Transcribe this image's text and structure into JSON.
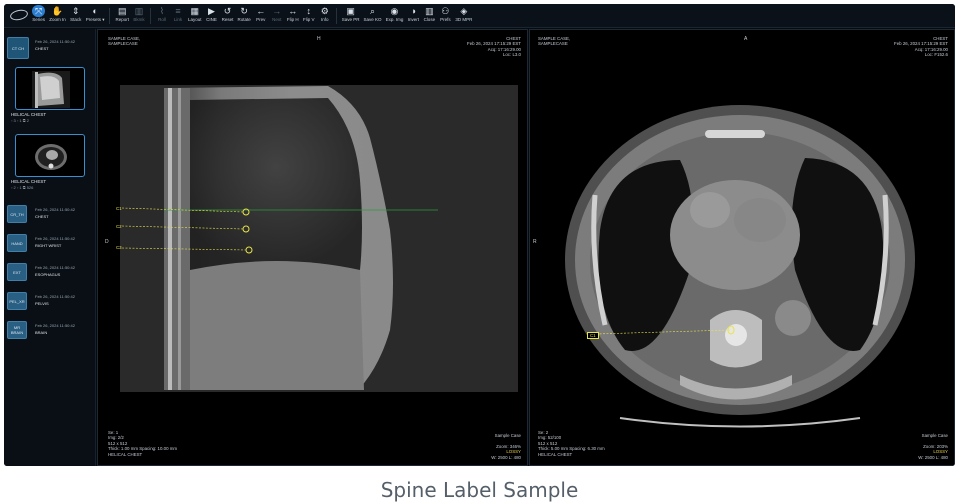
{
  "toolbar": {
    "tools": [
      {
        "icon": "⤧",
        "label": "Series",
        "active": true
      },
      {
        "icon": "✋",
        "label": "Zoom In"
      },
      {
        "icon": "⇕",
        "label": "Stack"
      },
      {
        "icon": "◐",
        "label": "Presets ▾"
      },
      {
        "icon": "▤",
        "label": "Report"
      },
      {
        "icon": "▥",
        "label": "Bkmk",
        "dim": true
      },
      {
        "icon": "⌇",
        "label": "Roll",
        "dim": true
      },
      {
        "icon": "≡",
        "label": "Link",
        "dim": true
      },
      {
        "icon": "▦",
        "label": "Layout"
      },
      {
        "icon": "▶",
        "label": "CINE"
      },
      {
        "icon": "↺",
        "label": "Reset"
      },
      {
        "icon": "↻",
        "label": "Rotate"
      },
      {
        "icon": "←",
        "label": "Prev"
      },
      {
        "icon": "→",
        "label": "Next",
        "dim": true
      },
      {
        "icon": "↔",
        "label": "Flip H"
      },
      {
        "icon": "↕",
        "label": "Flip V"
      },
      {
        "icon": "⚙",
        "label": "Info"
      },
      {
        "icon": "▣",
        "label": "Save PR"
      },
      {
        "icon": "⌕",
        "label": "Save KO"
      },
      {
        "icon": "◉",
        "label": "Exp. Img"
      },
      {
        "icon": "◑",
        "label": "Invert"
      },
      {
        "icon": "▥",
        "label": "Close"
      },
      {
        "icon": "⚇",
        "label": "Prefs"
      },
      {
        "icon": "◈",
        "label": "3D MPR"
      }
    ]
  },
  "sidebar": {
    "study": {
      "abbr": "CT CH",
      "date": "Feb 26, 2024 11:50:42",
      "name": "CHEST"
    },
    "thumbs": [
      {
        "name": "HELICAL CHEST",
        "meta": "▫ 3        ▫ 1                    ⧉ 2"
      },
      {
        "name": "HELICAL CHEST",
        "meta": "▫ 2        ▫ 1              ⧉ 526"
      }
    ],
    "series": [
      {
        "abbr": "CR_TH",
        "date": "Feb 26, 2024 11:50:42",
        "name": "CHEST"
      },
      {
        "abbr": "HAND",
        "date": "Feb 26, 2024 11:50:42",
        "name": "RIGHT WRIST"
      },
      {
        "abbr": "EXT",
        "date": "Feb 26, 2024 11:50:42",
        "name": "ESOPHAGUS"
      },
      {
        "abbr": "PEL_XR",
        "date": "Feb 26, 2024 11:50:42",
        "name": "PELVIS"
      },
      {
        "abbr": "MR BRAIN",
        "date": "Feb 26, 2024 11:50:42",
        "name": "BRAIN"
      }
    ]
  },
  "viewport_left": {
    "top_left": "SAMPLE CASE,\nSAMPLECASE",
    "top_center": "H",
    "left_mid": "D",
    "bottom_left": "Se: 1\nImg: 2/2\n512 x 512\nThick: 1.00 mm Spacing: 10.00 mm\nHELICAL CHEST",
    "bottom_right_1": "Sample Case\n\nZoom: 346%",
    "bottom_right_lossy": "LOSSY",
    "bottom_right_2": "W: 2500 L: 480",
    "labels": [
      "C1",
      "C2",
      "C3"
    ]
  },
  "viewport_right": {
    "top_left": "SAMPLE CASE,\nSAMPLECASE",
    "top_center": "A",
    "top_right": "CHEST\nFeb 26, 2024 17:15:29 EST\nAcq: 17:16:29.00\nLoc: F152.6",
    "left_mid": "R",
    "bottom_left": "Se: 2\nImg: 52/100\n512 x 512\nThick: 5.00 mm Spacing: 6.30 mm\nHELICAL CHEST",
    "bottom_right_1": "Sample Case\n\nZoom: 203%",
    "bottom_right_lossy": "LOSSY",
    "bottom_right_2": "W: 2500 L: 480",
    "label": "C1"
  },
  "viewport_left_right": "CHEST\nFeb 26, 2024 17:15:29 EST\nAcq: 17:16:29.00\nLoc: L3.0",
  "caption": "Spine Label Sample",
  "colors": {
    "accent": "#2c7fd0",
    "annotation": "#e8e44a",
    "reference_line": "#2e9a3a"
  }
}
